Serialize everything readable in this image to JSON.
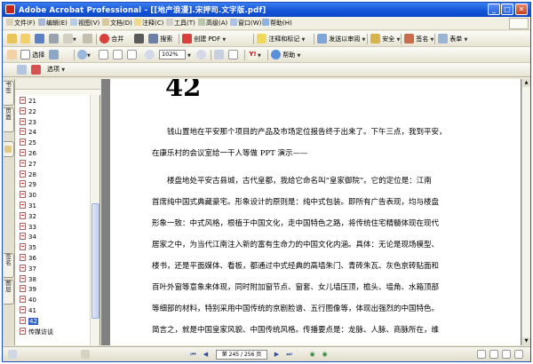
{
  "window": {
    "title": "Adobe Acrobat Professional - [[地产浪漫].宋押司.文字版.pdf]",
    "minimize": "_",
    "maximize": "□",
    "close": "✕"
  },
  "menu": {
    "items": [
      "文件(F)",
      "编辑(E)",
      "视图(V)",
      "文档(D)",
      "注释(C)",
      "工具(T)",
      "高级(A)",
      "窗口(W)",
      "帮助(H)"
    ]
  },
  "toolbar1": {
    "labels": [
      "创建 PDF",
      "注释和标记",
      "发送以审阅",
      "安全",
      "签名",
      "表单"
    ],
    "combine_label": "合并",
    "search_label": "搜索"
  },
  "toolbar2": {
    "select_label": "选择",
    "zoom_value": "102%",
    "help_label": "帮助"
  },
  "sidebar": {
    "tabs": [
      "书签",
      "页面",
      "签名",
      "图层"
    ],
    "options_label": "选项",
    "bookmarks": [
      "21",
      "22",
      "23",
      "24",
      "25",
      "26",
      "27",
      "28",
      "29",
      "30",
      "31",
      "32",
      "33",
      "34",
      "35",
      "36",
      "37",
      "38",
      "39",
      "40",
      "41",
      "42",
      "传媒访谈"
    ],
    "selected": "42"
  },
  "document": {
    "number": "42",
    "para1": [
      "钱山置地在平安那个项目的产品及市场定位报告终于出来了。下午三点，我到平安，",
      "在康乐村的会议室给一干人等做 PPT 演示——"
    ],
    "para2": [
      "楼盘地处平安古县城，古代皇都，我给它命名叫“皇家御院”。它的定位是：江南",
      "首席纯中国式典藏豪宅。形象设计的原则是：纯中式包装。即所有广告表现，均与楼盘",
      "形象一致：中式风格，根植于中国文化，走中国特色之路，将传统住宅精髓体现在现代",
      "居家之中，为当代江南注入新的富有生命力的中国文化内涵。具体：无论是现场模型、",
      "楼书，还是平面媒体、看板，都通过中式经典的高墙朱门、青砖朱瓦、灰色京砖贴面和",
      "百叶外窗等意象来体现，同时附加窗节点、窗套、女儿墙压顶，檐头、墙角、水箱顶部",
      "等细部的材料，特别采用中国传统的京剧脸谱、五行图像等，体现出强烈的中国特色。",
      "简言之，就是中国皇家风貌、中国传统风格。传播要点是：龙脉、人脉、商脉所在，维"
    ]
  },
  "status": {
    "page_indicator": "第 245 / 256 页"
  },
  "colors": {
    "titlebar": "#1655d8",
    "selection": "#3161c5",
    "doc_background": "#808080"
  }
}
